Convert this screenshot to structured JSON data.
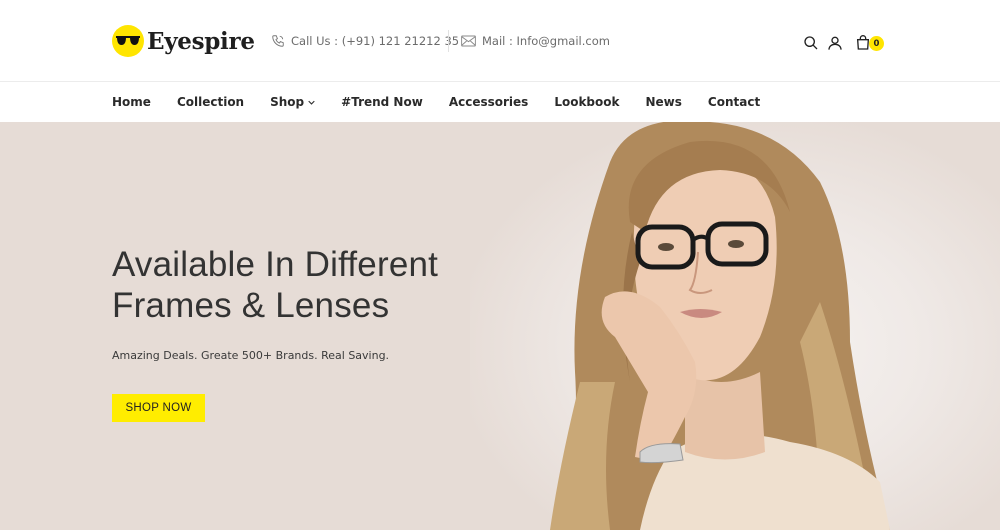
{
  "brand": {
    "name": "Eyespire",
    "accent": "#ffe500"
  },
  "header": {
    "phone_label": "Call Us : (+91) 121 21212 35",
    "mail_label": "Mail : Info@gmail.com",
    "icons": [
      "phone-icon",
      "mail-icon",
      "search-icon",
      "user-icon",
      "cart-icon"
    ],
    "cart_count": "0"
  },
  "nav": {
    "items": [
      {
        "label": "Home"
      },
      {
        "label": "Collection"
      },
      {
        "label": "Shop",
        "has_dropdown": true
      },
      {
        "label": "#Trend Now"
      },
      {
        "label": "Accessories"
      },
      {
        "label": "Lookbook"
      },
      {
        "label": "News"
      },
      {
        "label": "Contact"
      }
    ]
  },
  "hero": {
    "title_line1": "Available In Different",
    "title_line2": "Frames & Lenses",
    "subtitle": "Amazing Deals. Greate 500+ Brands. Real Saving.",
    "cta_label": "SHOP NOW",
    "background": "#e6dcd6",
    "cta_color": "#ffed00"
  }
}
